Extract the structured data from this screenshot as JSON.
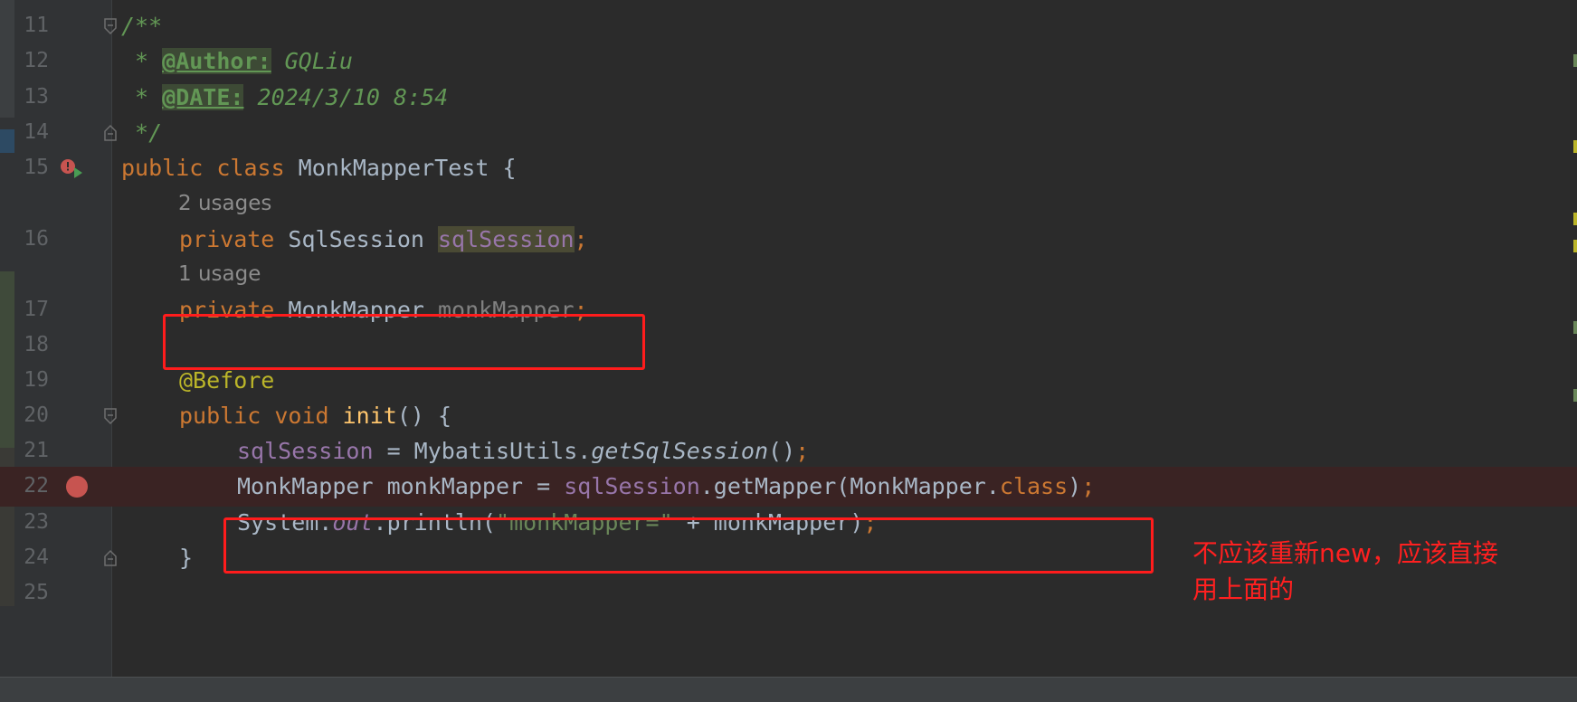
{
  "lines": [
    {
      "num": "11"
    },
    {
      "num": "12"
    },
    {
      "num": "13"
    },
    {
      "num": "14"
    },
    {
      "num": "15"
    },
    {
      "num": "16"
    },
    {
      "num": "17"
    },
    {
      "num": "18"
    },
    {
      "num": "19"
    },
    {
      "num": "20"
    },
    {
      "num": "21"
    },
    {
      "num": "22"
    },
    {
      "num": "23"
    },
    {
      "num": "24"
    },
    {
      "num": "25"
    }
  ],
  "code": {
    "l11": "/**",
    "l12_star": " * ",
    "l12_tag": "@Author:",
    "l12_val": " GQLiu",
    "l13_star": " * ",
    "l13_tag": "@DATE:",
    "l13_val": " 2024/3/10 8:54",
    "l14": " */",
    "l15_kw": "public class ",
    "l15_rest": "MonkMapperTest {",
    "usages_16": "2 usages",
    "l16_kw": "private ",
    "l16_type": "SqlSession ",
    "l16_field": "sqlSession",
    "usages_17": "1 usage",
    "l17_kw": "private ",
    "l17_type": "MonkMapper ",
    "l17_field": "monkMapper",
    "l19_ann": "@Before",
    "l20_kw": "public void ",
    "l20_fn": "init",
    "l20_rest": "() {",
    "l21_field": "sqlSession",
    "l21_eq": " = MybatisUtils.",
    "l21_call": "getSqlSession",
    "l21_rest": "()",
    "l22_a": "MonkMapper monkMapper = ",
    "l22_field": "sqlSession",
    "l22_b": ".getMapper(MonkMapper.",
    "l22_kw": "class",
    "l22_c": ")",
    "l23_a": "System.",
    "l23_out": "out",
    "l23_b": ".println(",
    "l23_str": "\"monkMapper=\"",
    "l23_c": " + monkMapper)",
    "l24": "}",
    "semi": ";"
  },
  "annotation_note": "不应该重新new，应该直接\n用上面的",
  "colors": {
    "background": "#2b2b2b",
    "gutter": "#313335",
    "keyword": "#cc7832",
    "field": "#9876aa",
    "comment": "#629755",
    "annotation": "#bbb529",
    "method": "#ffc66d",
    "string": "#6a8759",
    "highlight_box": "#ff1c1c",
    "breakpoint": "#c75450"
  },
  "icons": {
    "line15": "run-test-icon",
    "line22": "breakpoint-icon",
    "folds": "fold-marker-icon"
  }
}
